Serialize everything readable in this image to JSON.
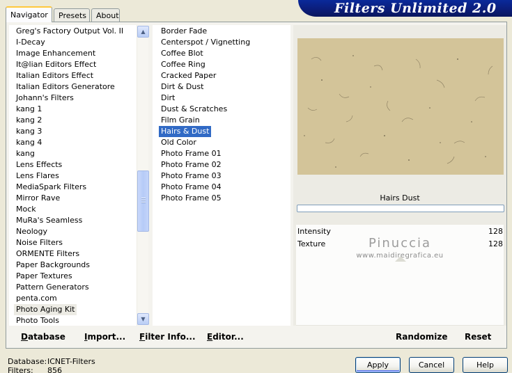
{
  "window": {
    "banner_title": "Filters Unlimited 2.0"
  },
  "tabs": [
    {
      "label": "Navigator",
      "active": true
    },
    {
      "label": "Presets",
      "active": false
    },
    {
      "label": "About",
      "active": false
    }
  ],
  "categories": {
    "items": [
      "Greg's Factory Output Vol. II",
      "I-Decay",
      "Image Enhancement",
      "It@lian Editors Effect",
      "Italian Editors Effect",
      "Italian Editors Generatore",
      "Johann's Filters",
      "kang 1",
      "kang 2",
      "kang 3",
      "kang 4",
      "kang",
      "Lens Effects",
      "Lens Flares",
      "MediaSpark Filters",
      "Mirror Rave",
      "Mock",
      "MuRa's Seamless",
      "Neology",
      "Noise Filters",
      "ORMENTE Filters",
      "Paper Backgrounds",
      "Paper Textures",
      "Pattern Generators",
      "penta.com",
      "Photo Aging Kit",
      "Photo Tools"
    ],
    "selected_index": 25
  },
  "filters": {
    "items": [
      "Border Fade",
      "Centerspot / Vignetting",
      "Coffee Blot",
      "Coffee Ring",
      "Cracked Paper",
      "Dirt & Dust",
      "Dirt",
      "Dust & Scratches",
      "Film Grain",
      "Hairs & Dust",
      "Old Color",
      "Photo Frame 01",
      "Photo Frame 02",
      "Photo Frame 03",
      "Photo Frame 04",
      "Photo Frame 05"
    ],
    "selected_index": 9
  },
  "preview": {
    "filter_name": "Hairs  Dust",
    "progress_percent": 0,
    "parameters": [
      {
        "name": "Intensity",
        "value": "128"
      },
      {
        "name": "Texture",
        "value": "128"
      }
    ],
    "empty_rows": 6,
    "watermark": "Pinuccia",
    "watermark_url": "www.maidiregrafica.eu"
  },
  "commands": {
    "database": {
      "label": "Database",
      "accel": "D"
    },
    "import": {
      "label": "Import...",
      "accel": "I"
    },
    "filter_info": {
      "label": "Filter Info...",
      "accel": "F"
    },
    "editor": {
      "label": "Editor...",
      "accel": "E"
    },
    "randomize": "Randomize",
    "reset": "Reset"
  },
  "status": {
    "database_label": "Database:",
    "database_value": "ICNET-Filters",
    "filters_label": "Filters:",
    "filters_value": "856"
  },
  "buttons": {
    "apply": "Apply",
    "cancel": "Cancel",
    "help": "Help"
  },
  "colors": {
    "selection": "#316ac5",
    "banner": "#0b1d7a",
    "preview_paper": "#d3c499"
  }
}
